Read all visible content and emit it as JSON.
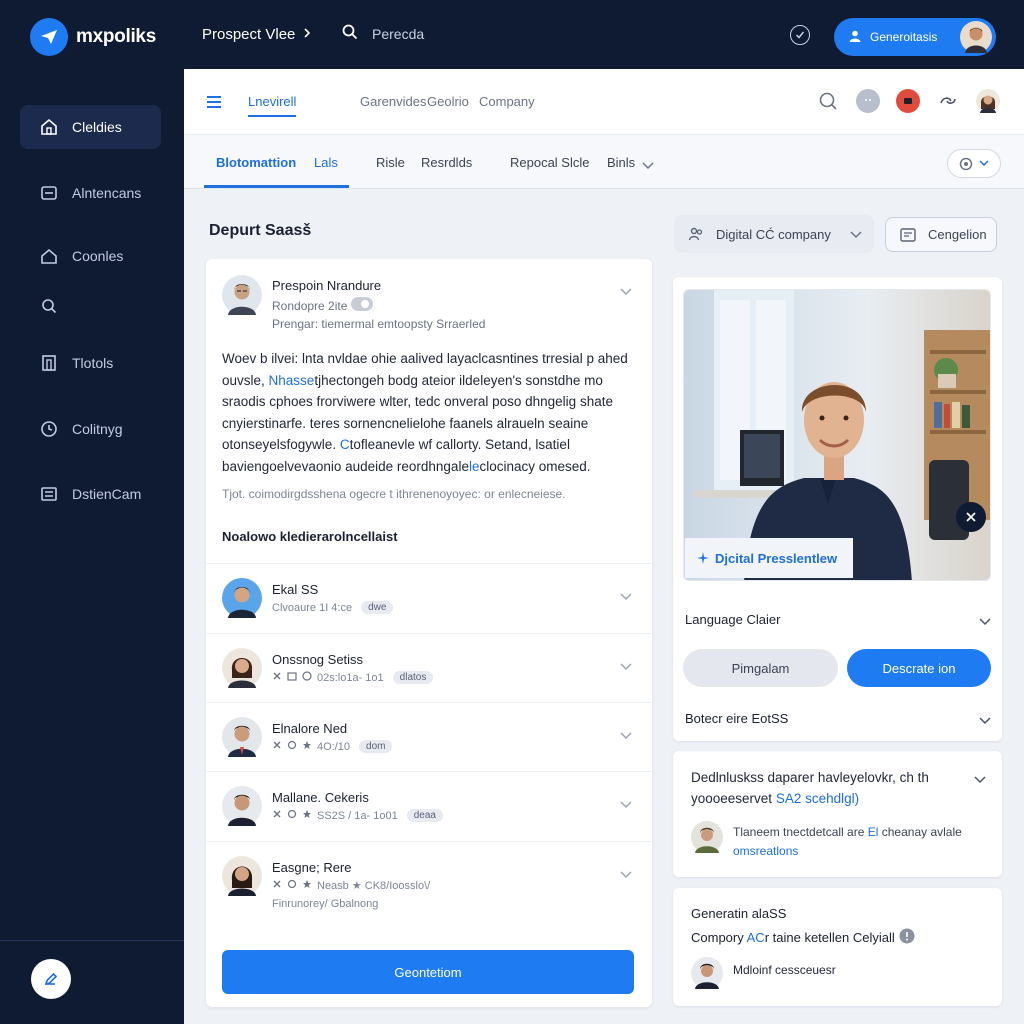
{
  "app": {
    "brand": "mxpoliks",
    "breadcrumb": "Prospect Vlee",
    "search_placeholder": "Perecda",
    "user_button": "Generoitasis"
  },
  "sidebar": {
    "items": [
      {
        "label": "Cleldies",
        "icon": "home-icon"
      },
      {
        "label": "Alntencans",
        "icon": "inbox-icon"
      },
      {
        "label": "Coonles",
        "icon": "house-icon"
      },
      {
        "label": "",
        "icon": "search-icon"
      },
      {
        "label": "Tlotols",
        "icon": "door-icon"
      },
      {
        "label": "Colitnyg",
        "icon": "clock-icon"
      },
      {
        "label": "DstienCam",
        "icon": "list-icon"
      }
    ]
  },
  "subheader": {
    "tabs": [
      "Lnevirell",
      "Garenvides",
      "Geolrio",
      "Company"
    ]
  },
  "tabs": [
    "Blotomattion",
    "Lals",
    "Risle",
    "Resrdlds",
    "Repocal Slcle",
    "Binls"
  ],
  "section": {
    "title": "Depurt Saasš",
    "company_select": "Digital CĆ company",
    "condition_button": "Cengelion"
  },
  "main_card": {
    "header": {
      "name": "Prespoin Nrandure",
      "sub": "Rondopre 2ite",
      "sub2": "Prengar:  tiemermal emtoopsty Srraerled"
    },
    "body": [
      {
        "t": "Woev b ilvei: lnta nvldae ohie aalived layaclcasntines trresial p ahed ouvsle, "
      },
      {
        "t": "Nhasse",
        "blue": true
      },
      {
        "t": "tjhectongeh bodg ateior ildeleyen's sonstdhe mo sraodis cphoes frorviwere wlter, tedc onveral poso dhngelig shate cnyierstinarfe. teres sornencnelielohe faanels alraueln seaine otonseyelsfogywle. "
      },
      {
        "t": "C",
        "blue": true
      },
      {
        "t": "tofleanevle wf callorty. Setand, lsatiel baviengoelvevaonio audeide reordhngale"
      },
      {
        "t": "le",
        "blue": true
      },
      {
        "t": "clocinacy omesed."
      }
    ],
    "note": "Tjot. coimodirgdsshena ogecre t ithrenenoyoyec: or enlecneiese.",
    "list_title": "Noalowo kledierarolncellaist",
    "rows": [
      {
        "name": "Ekal SS",
        "meta": "Clvoaure 1I 4:ce",
        "tag": "dwe",
        "icons": 0
      },
      {
        "name": "Onssnog Setiss",
        "meta": "02s:lo1a- 1o1",
        "tag": "dlatos",
        "icons": 3
      },
      {
        "name": "Elnalore Ned",
        "meta": "4O:/10",
        "tag": "dom",
        "icons": 3
      },
      {
        "name": "Mallane. Cekeris",
        "meta": "SS2S / 1a- 1o01",
        "tag": "deaa",
        "icons": 3
      },
      {
        "name": "Easgne; Rere",
        "meta": "Neasb  ★  CK8/Ioosslo\\/",
        "tag": "",
        "icons": 3,
        "extra": "Finrunorey/ Gbalnong"
      }
    ],
    "cta": "Geontetiom"
  },
  "right_card": {
    "photo_label": "Djcital Presslentlew",
    "row1": "Language Claier",
    "toggle_left": "Pimgalam",
    "toggle_right": "Descrate ion",
    "row2": "Botecr eire EotSS"
  },
  "right_card2": {
    "text_a": "Dedlnluskss daparer havleyelovkr, ch th yoooeeservet ",
    "text_b": "SA2 scehdlgl)",
    "person_a": "Tlaneem tnectdetcall are ",
    "person_b": "El",
    "person_c": " cheanay avlale",
    "person_d": "omsreatlons"
  },
  "right_card3": {
    "title": "Generatin alaSS",
    "line_a": "Compory ",
    "line_b": "AC",
    "line_c": "r taine ketellen Celyiall",
    "person": "Mdloinf cessceuesr"
  },
  "colors": {
    "navy": "#0f1a33",
    "accent": "#1e7bf2",
    "link": "#1e6fe0"
  }
}
